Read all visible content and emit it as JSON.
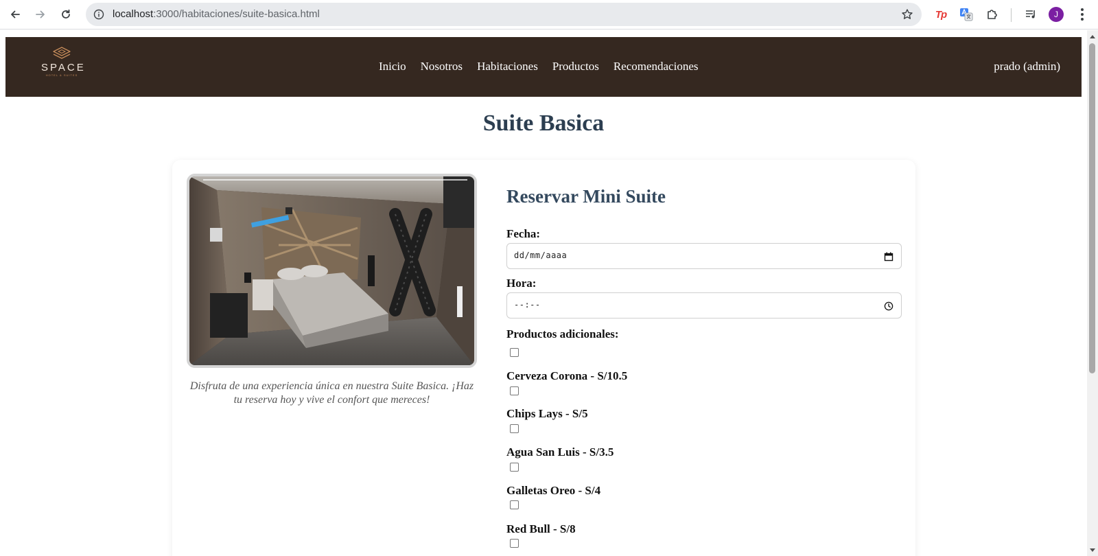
{
  "browser": {
    "url_host": "localhost",
    "url_path": ":3000/habitaciones/suite-basica.html",
    "profile_initial": "J",
    "extensions": {
      "tp_label": "Tp"
    }
  },
  "site": {
    "logo": {
      "brand": "SPACE",
      "tagline": "HOTEL & SUITES"
    },
    "nav": [
      "Inicio",
      "Nosotros",
      "Habitaciones",
      "Productos",
      "Recomendaciones"
    ],
    "user": "prado (admin)"
  },
  "page": {
    "title": "Suite Basica",
    "description": "Disfruta de una experiencia única en nuestra Suite Basica. ¡Haz tu reserva hoy y vive el confort que mereces!"
  },
  "booking_form": {
    "title": "Reservar Mini Suite",
    "date_label": "Fecha:",
    "date_placeholder": "dd/mm/aaaa",
    "time_label": "Hora:",
    "time_placeholder": "--:--",
    "products_label": "Productos adicionales:",
    "products": [
      {
        "label": "Cerveza Corona - S/10.5",
        "checked": false
      },
      {
        "label": "Chips Lays - S/5",
        "checked": false
      },
      {
        "label": "Agua San Luis - S/3.5",
        "checked": false
      },
      {
        "label": "Galletas Oreo - S/4",
        "checked": false
      },
      {
        "label": "Red Bull - S/8",
        "checked": false
      }
    ]
  },
  "colors": {
    "header_bg": "#352820",
    "title_text": "#2c3e50",
    "logo_accent": "#c48a5a",
    "avatar_bg": "#7b1fa2"
  }
}
